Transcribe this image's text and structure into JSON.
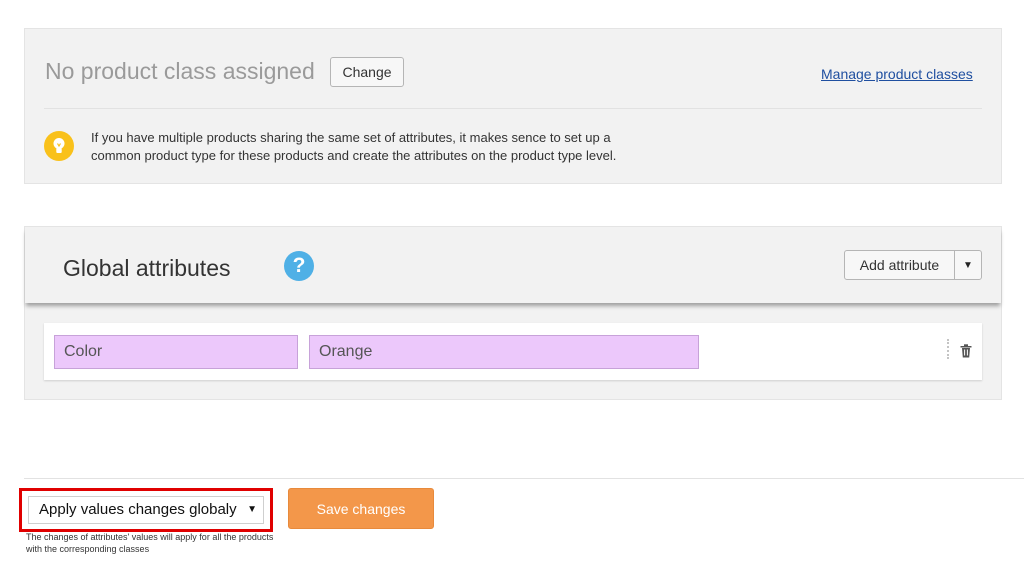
{
  "product_class": {
    "title": "No product class assigned",
    "change_label": "Change",
    "manage_link": "Manage product classes",
    "tip_line1": "If you have multiple products sharing the same set of attributes, it makes sence to set up a",
    "tip_line2": "common product type for these products and create the attributes on the product type level."
  },
  "global_attributes": {
    "title": "Global attributes",
    "help_glyph": "?",
    "add_label": "Add attribute",
    "attributes": [
      {
        "name": "Color",
        "value": "Orange"
      }
    ]
  },
  "footer": {
    "apply_option": "Apply values changes globaly",
    "note": "The changes of attributes' values will apply for all the products with the corresponding classes",
    "save_label": "Save changes"
  },
  "colors": {
    "attribute_field_bg": "#ecc8fb",
    "save_button_bg": "#f3974a",
    "tip_icon": "#f9c11b",
    "help_icon": "#4fb0e6",
    "highlight_border": "#e00000"
  }
}
